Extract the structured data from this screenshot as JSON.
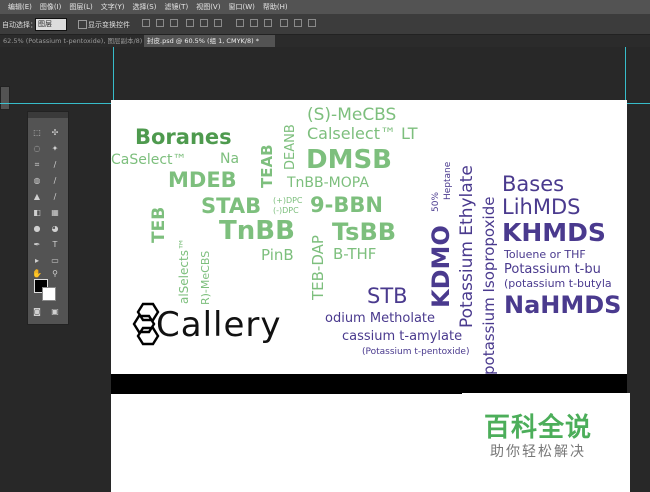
{
  "menu": [
    "编辑(E)",
    "图像(I)",
    "图层(L)",
    "文字(Y)",
    "选择(S)",
    "滤镜(T)",
    "视图(V)",
    "窗口(W)",
    "帮助(H)"
  ],
  "options": {
    "auto_select_label": "自动选择：",
    "auto_select_value": "图层",
    "show_transform_label": "显示变换控件"
  },
  "tabs": [
    {
      "label": "62.5% (Potassium t-pentoxide), 图层副本/8)",
      "active": false
    },
    {
      "label": "封皮.psd @ 60.5% (组 1, CMYK/8) *",
      "active": true
    }
  ],
  "canvas_words": [
    {
      "id": "boranes",
      "text": "Boranes",
      "color": "#4e9a4e"
    },
    {
      "id": "caselect",
      "text": "CaSelect™",
      "color": "#7dbf7d"
    },
    {
      "id": "na",
      "text": "Na",
      "color": "#7dbf7d"
    },
    {
      "id": "mdeb",
      "text": "MDEB",
      "color": "#7dbf7d"
    },
    {
      "id": "teb-v",
      "text": "TEB",
      "color": "#7dbf7d"
    },
    {
      "id": "alselects",
      "text": "alSelects™",
      "color": "#7dbf7d"
    },
    {
      "id": "mecbs-v",
      "text": "R)-MeCBS",
      "color": "#7dbf7d"
    },
    {
      "id": "stab",
      "text": "STAB",
      "color": "#7dbf7d"
    },
    {
      "id": "dpc-plus",
      "text": "(+)DPC",
      "color": "#7dbf7d"
    },
    {
      "id": "dpc-minus",
      "text": "(-)DPC",
      "color": "#7dbf7d"
    },
    {
      "id": "tnbb",
      "text": "TnBB",
      "color": "#7dbf7d"
    },
    {
      "id": "pinb",
      "text": "PinB",
      "color": "#7dbf7d"
    },
    {
      "id": "teab",
      "text": "TEAB",
      "color": "#7dbf7d"
    },
    {
      "id": "deanb",
      "text": "DEANB",
      "color": "#7dbf7d"
    },
    {
      "id": "s-mecbs",
      "text": "(S)-MeCBS",
      "color": "#7dbf7d"
    },
    {
      "id": "calselect-lt",
      "text": "Calselect™ LT",
      "color": "#7dbf7d"
    },
    {
      "id": "dmsb",
      "text": "DMSB",
      "color": "#7dbf7d"
    },
    {
      "id": "tnbb-mopa",
      "text": "TnBB-MOPA",
      "color": "#7dbf7d"
    },
    {
      "id": "9-bbn",
      "text": "9-BBN",
      "color": "#7dbf7d"
    },
    {
      "id": "teb-dap",
      "text": "TEB-DAP",
      "color": "#7dbf7d"
    },
    {
      "id": "tsbb",
      "text": "TsBB",
      "color": "#7dbf7d"
    },
    {
      "id": "b-thf",
      "text": "B-THF",
      "color": "#7dbf7d"
    },
    {
      "id": "stb",
      "text": "STB",
      "color": "#4a3a8e"
    },
    {
      "id": "kdmo",
      "text": "KDMO",
      "color": "#4a3a8e"
    },
    {
      "id": "pct50",
      "text": "50%",
      "color": "#4a3a8e"
    },
    {
      "id": "heptane",
      "text": "Heptane",
      "color": "#4a3a8e"
    },
    {
      "id": "k-ethylate",
      "text": "Potassium Ethylate",
      "color": "#4a3a8e"
    },
    {
      "id": "k-isopropoxide",
      "text": "potassium Isopropoxide",
      "color": "#4a3a8e"
    },
    {
      "id": "na-methoxide",
      "text": "odium Metholate",
      "color": "#4a3a8e"
    },
    {
      "id": "k-amylate",
      "text": "cassium t-amylate",
      "color": "#4a3a8e"
    },
    {
      "id": "k-pentoxide",
      "text": "(Potassium t-pentoxide)",
      "color": "#4a3a8e"
    },
    {
      "id": "bases",
      "text": "Bases",
      "color": "#4a3a8e"
    },
    {
      "id": "lihmds",
      "text": "LihMDS",
      "color": "#4a3a8e"
    },
    {
      "id": "khmds",
      "text": "KHMDS",
      "color": "#4a3a8e"
    },
    {
      "id": "toluene",
      "text": "Toluene or THF",
      "color": "#4a3a8e"
    },
    {
      "id": "k-tbu",
      "text": "Potassium t-bu",
      "color": "#4a3a8e"
    },
    {
      "id": "k-tbutyla",
      "text": "(potassium t-butyla",
      "color": "#4a3a8e"
    },
    {
      "id": "nahmds",
      "text": "NaHMDS",
      "color": "#4a3a8e"
    }
  ],
  "logo_text": "Callery",
  "watermark": {
    "title": "百科全说",
    "subtitle": "助你轻松解决",
    "color": "#4cae5a"
  }
}
